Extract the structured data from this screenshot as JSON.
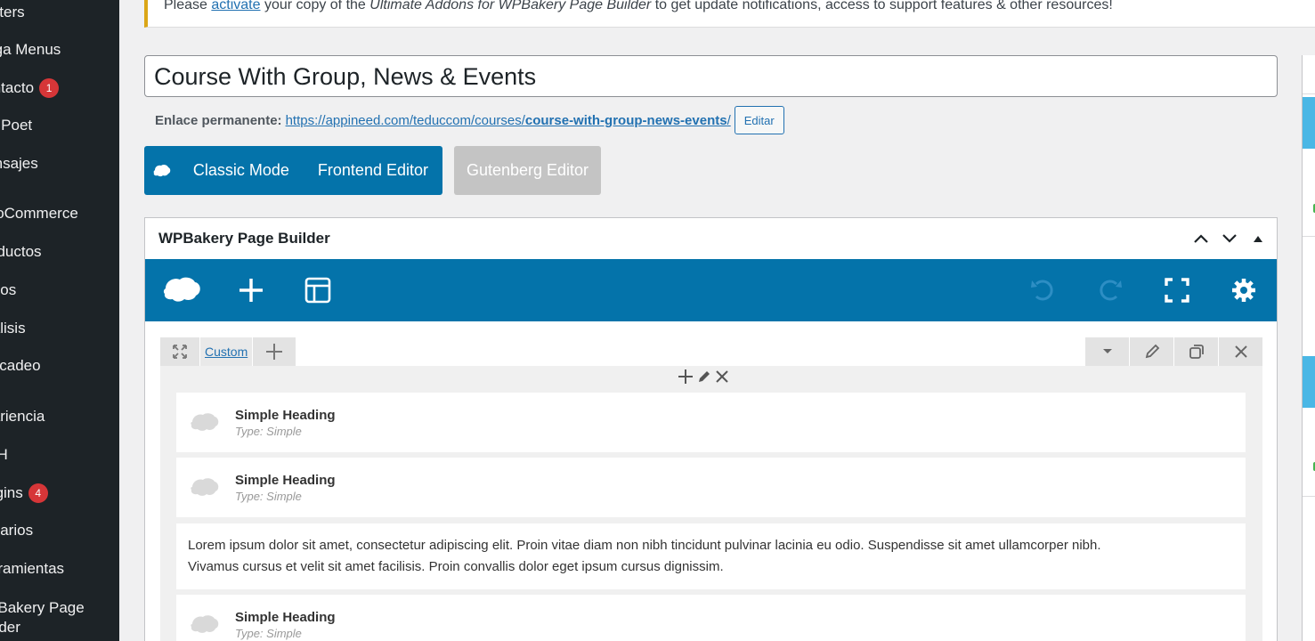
{
  "sidebar": {
    "items": [
      {
        "label": "Footers"
      },
      {
        "label": "Mega Menus"
      },
      {
        "label": "Contacto",
        "badge": "1"
      },
      {
        "label": "MailPoet"
      },
      {
        "label": "Mensajes"
      },
      {
        "label": "WooCommerce"
      },
      {
        "label": "Productos"
      },
      {
        "label": "Pagos"
      },
      {
        "label": "Análisis"
      },
      {
        "label": "Mercadeo"
      },
      {
        "label": "Apariencia"
      },
      {
        "label": "YITH"
      },
      {
        "label": "Plugins",
        "badge": "4"
      },
      {
        "label": "Usuarios"
      },
      {
        "label": "Herramientas"
      },
      {
        "label": "WPBakery Page Builder"
      }
    ]
  },
  "notice": {
    "prefix": "Please",
    "link": "activate",
    "middle": "your copy of the",
    "product": "Ultimate Addons for WPBakery Page Builder",
    "suffix": "to get update notifications, access to support features & other resources!"
  },
  "post": {
    "title": "Course With Group, News & Events"
  },
  "permalink": {
    "label": "Enlace permanente:",
    "url_base": "https://appineed.com/teduccom/courses/",
    "url_slug": "course-with-group-news-events",
    "url_end": "/",
    "edit_label": "Editar"
  },
  "modes": {
    "classic": "Classic Mode",
    "frontend": "Frontend Editor",
    "gutenberg": "Gutenberg Editor"
  },
  "builder": {
    "title": "WPBakery Page Builder",
    "row_layout_label": "Custom",
    "elements": [
      {
        "type": "heading",
        "title": "Simple Heading",
        "subtitle": "Type: Simple"
      },
      {
        "type": "heading",
        "title": "Simple Heading",
        "subtitle": "Type: Simple"
      },
      {
        "type": "text",
        "text_line1": "Lorem ipsum dolor sit amet, consectetur adipiscing elit. Proin vitae diam non nibh tincidunt pulvinar lacinia eu odio. Suspendisse sit amet ullamcorper nibh.",
        "text_line2": "Vivamus cursus et velit sit amet facilisis. Proin convallis dolor eget ipsum cursus dignissim."
      },
      {
        "type": "heading",
        "title": "Simple Heading",
        "subtitle": "Type: Simple"
      }
    ]
  },
  "colors": {
    "accent": "#0473aa",
    "sidebar_bg": "#1d2327",
    "badge": "#d63638",
    "notice_border": "#dba617",
    "link": "#2271b1"
  }
}
